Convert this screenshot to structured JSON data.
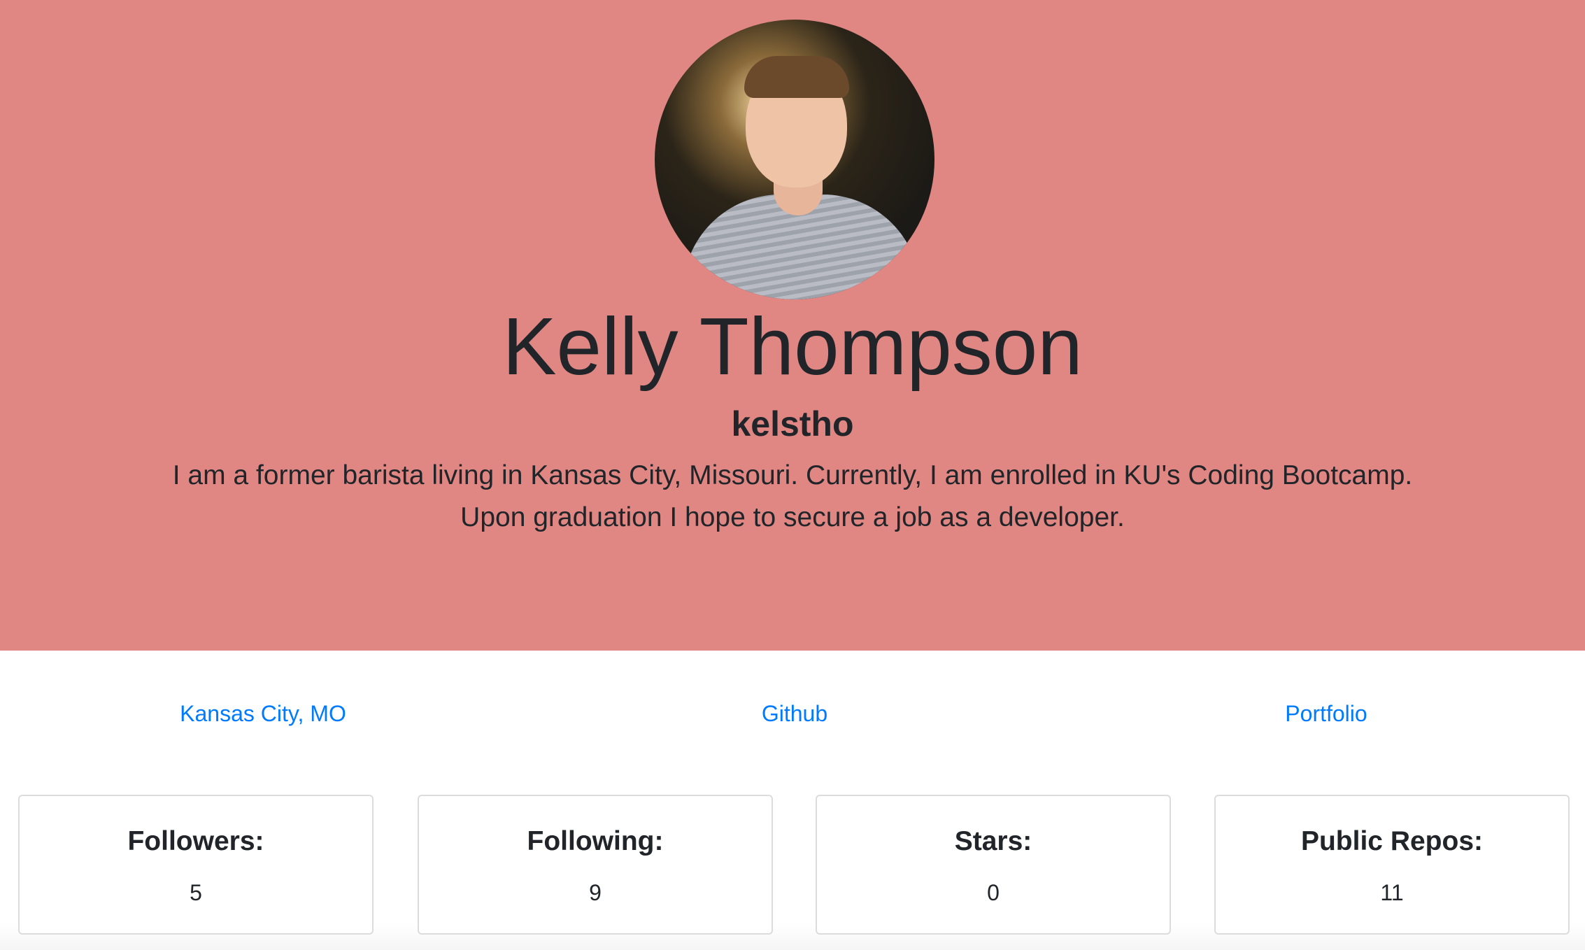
{
  "profile": {
    "name": "Kelly Thompson",
    "username": "kelstho",
    "bio": "I am a former barista living in Kansas City, Missouri. Currently, I am enrolled in KU's Coding Bootcamp. Upon graduation I hope to secure a job as a developer.",
    "hero_color": "#e18783"
  },
  "links": {
    "location": "Kansas City, MO",
    "github": "Github",
    "portfolio": "Portfolio",
    "link_color": "#007bff"
  },
  "stats": [
    {
      "label": "Followers:",
      "value": "5"
    },
    {
      "label": "Following:",
      "value": "9"
    },
    {
      "label": "Stars:",
      "value": "0"
    },
    {
      "label": "Public Repos:",
      "value": "11"
    }
  ]
}
